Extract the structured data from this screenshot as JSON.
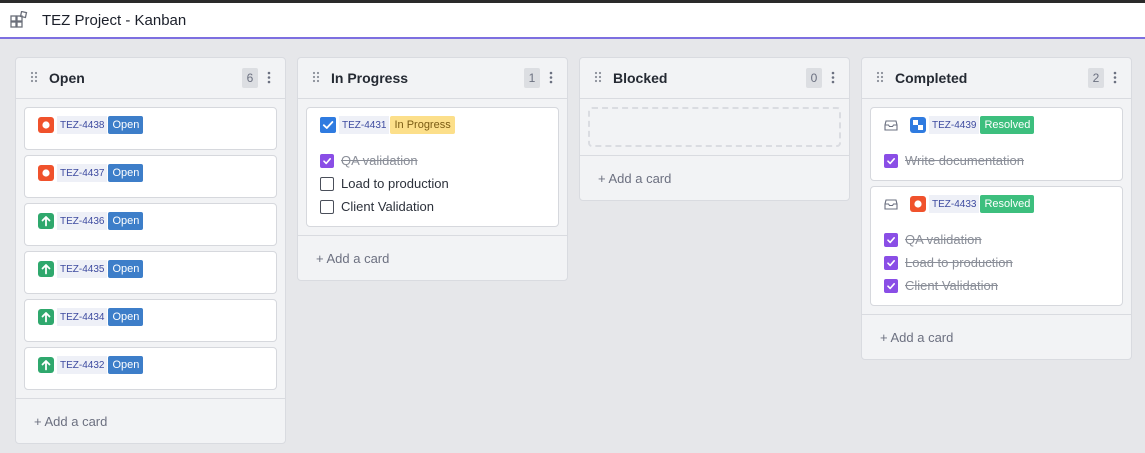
{
  "app": {
    "title": "TEZ Project - Kanban"
  },
  "add_card_label": "+ Add a card",
  "colors": {
    "accent": "#7d6fe0",
    "open": "#3d7ec9",
    "in_progress": "#fcdf8a",
    "resolved": "#3dbf7e",
    "bug": "#f0522c",
    "story": "#2fa86d",
    "task": "#2f7be0",
    "checkbox": "#8a4ee6"
  },
  "columns": [
    {
      "title": "Open",
      "count": "6",
      "cards": [
        {
          "key": "TEZ-4438",
          "status": "Open",
          "type": "bug-icon"
        },
        {
          "key": "TEZ-4437",
          "status": "Open",
          "type": "bug-icon"
        },
        {
          "key": "TEZ-4436",
          "status": "Open",
          "type": "arrow-up-icon"
        },
        {
          "key": "TEZ-4435",
          "status": "Open",
          "type": "arrow-up-icon"
        },
        {
          "key": "TEZ-4434",
          "status": "Open",
          "type": "arrow-up-icon"
        },
        {
          "key": "TEZ-4432",
          "status": "Open",
          "type": "arrow-up-icon"
        }
      ]
    },
    {
      "title": "In Progress",
      "count": "1",
      "cards": [
        {
          "key": "TEZ-4431",
          "status": "In Progress",
          "type": "checkbox-icon",
          "tasks": [
            {
              "text": "QA validation",
              "done": true
            },
            {
              "text": "Load to production",
              "done": false
            },
            {
              "text": "Client Validation",
              "done": false
            }
          ]
        }
      ]
    },
    {
      "title": "Blocked",
      "count": "0",
      "cards": []
    },
    {
      "title": "Completed",
      "count": "2",
      "cards": [
        {
          "key": "TEZ-4439",
          "status": "Resolved",
          "type": "task-icon",
          "tasks": [
            {
              "text": "Write documentation",
              "done": true
            }
          ]
        },
        {
          "key": "TEZ-4433",
          "status": "Resolved",
          "type": "bug-icon",
          "tasks": [
            {
              "text": "QA validation",
              "done": true
            },
            {
              "text": "Load to production",
              "done": true
            },
            {
              "text": "Client Validation",
              "done": true
            }
          ]
        }
      ]
    }
  ]
}
